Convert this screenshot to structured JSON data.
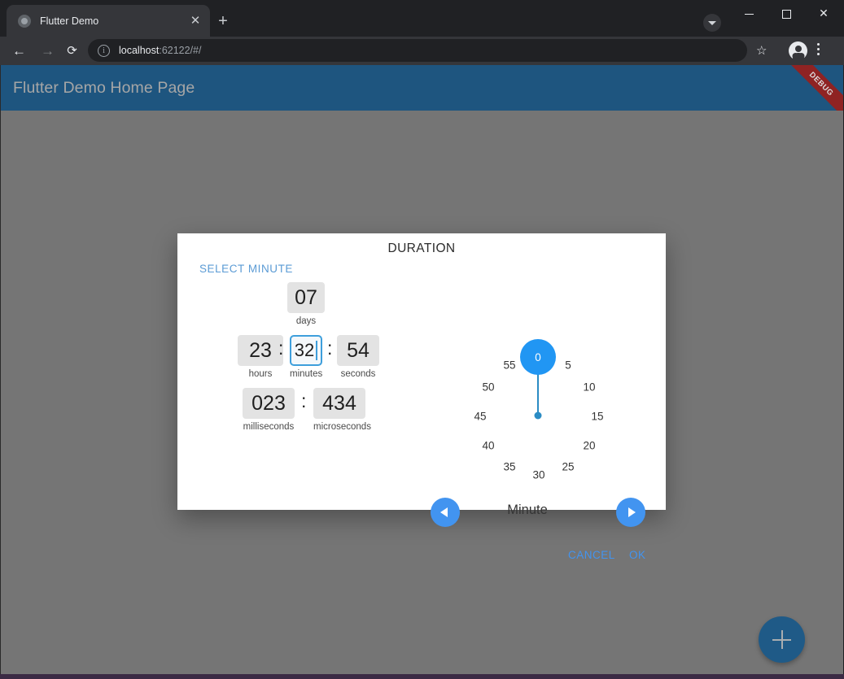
{
  "browser": {
    "tab": {
      "title": "Flutter Demo",
      "favicon": "globe-icon",
      "close": "✕"
    },
    "new_tab": "+",
    "tab_search": "chevron-down-icon",
    "window_controls": {
      "minimize": "—",
      "maximize": "□",
      "close": "✕"
    },
    "nav": {
      "back": "←",
      "forward": "→",
      "reload": "⟳"
    },
    "omnibox": {
      "info_icon": "i",
      "url_host": "localhost",
      "url_rest": ":62122/#/"
    },
    "star": "☆",
    "menu": "kebab-menu-icon"
  },
  "app": {
    "appbar_title": "Flutter Demo Home Page",
    "debug_banner": "DEBUG",
    "fab_label": "+",
    "colors": {
      "appbar": "#1e557f",
      "scrim": "#757575",
      "debug": "#8f2323"
    }
  },
  "dialog": {
    "title": "DURATION",
    "select_label": "SELECT MINUTE",
    "fields": [
      {
        "value": "07",
        "unit": "days",
        "focused": false
      },
      {
        "value": "23",
        "unit": "hours",
        "focused": false
      },
      {
        "value": "32",
        "unit": "minutes",
        "focused": true
      },
      {
        "value": "54",
        "unit": "seconds",
        "focused": false
      },
      {
        "value": "023",
        "unit": "milliseconds",
        "focused": false
      },
      {
        "value": "434",
        "unit": "microseconds",
        "focused": false
      }
    ],
    "separator": ":",
    "clock": {
      "unit_name": "Minute",
      "selected": "0",
      "numbers": [
        "0",
        "5",
        "10",
        "15",
        "20",
        "25",
        "30",
        "35",
        "40",
        "45",
        "50",
        "55"
      ],
      "prev_icon": "triangle-left-icon",
      "next_icon": "triangle-right-icon",
      "accent": "#2196f3"
    },
    "actions": {
      "cancel": "CANCEL",
      "ok": "OK"
    }
  }
}
